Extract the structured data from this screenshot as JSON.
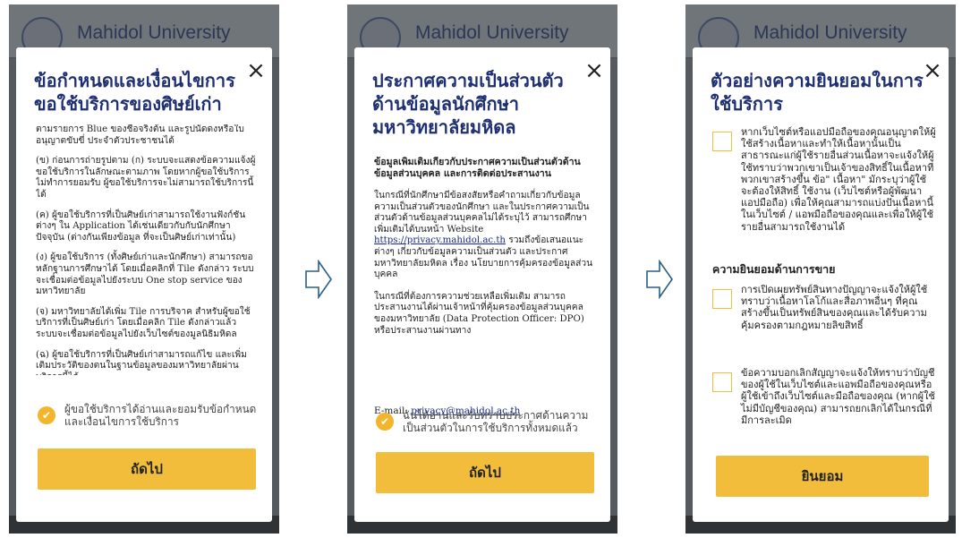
{
  "background": {
    "brand_name": "Mahidol University"
  },
  "screen1": {
    "title": "ข้อกำหนดและเงื่อนไขการขอใช้บริการของศิษย์เก่า",
    "paragraphs": [
      "ตามรายการ Blue ของชื่อจริงต้น และรูปนัดดงหรือใบอนุญาตขับขี่ ประจำตัวประชาชนได้",
      "(ข) ก่อนการถ่ายรูปตาม (ก) ระบบจะแสดงข้อความแจ้งผู้ขอใช้บริการในลักษณะตามภาพ โดยหากผู้ขอใช้บริการไม่ทำการยอมรับ ผู้ขอใช้บริการจะไม่สามารถใช้บริการนี้ได้",
      "(ค) ผู้ขอใช้บริการที่เป็นศิษย์เก่าสามารถใช้งานฟังก์ชันต่างๆ ใน Application ได้เช่นเดียวกับกับนักศึกษาปัจจุบัน (ต่างกันเพียงข้อมูล ที่จะเป็นศิษย์เก่าเท่านั้น)",
      "(ง) ผู้ขอใช้บริการ (ทั้งศิษย์เก่าและนักศึกษา) สามารถขอหลักฐานการศึกษาได้ โดยเมื่อคลิกที่ Tile ดังกล่าว ระบบจะเชื่อมต่อข้อมูลไปยังระบบ One stop service ของมหาวิทยาลัย",
      "(จ) มหาวิทยาลัยได้เพิ่ม Tile การบริจาค สำหรับผู้ขอใช้บริการที่เป็นศิษย์เก่า โดยเมื่อคลิก Tile ดังกล่าวแล้ว ระบบจะเชื่อมต่อข้อมูลไปยังเว็บไซต์ของมูลนิธิมหิดล",
      "(ฉ) ผู้ขอใช้บริการที่เป็นศิษย์เก่าสามารถแก้ไข และเพิ่มเติมประวัติของตนในฐานข้อมูลของมหาวิทยาลัยผ่านบริการนี้ได้"
    ],
    "consent_text": "ผู้ขอใช้บริการได้อ่านและยอมรับข้อกำหนดและเงื่อนไขการใช้บริการ",
    "next_label": "ถัดไป"
  },
  "screen2": {
    "title": "ประกาศความเป็นส่วนตัวด้านข้อมูลนักศึกษา มหาวิทยาลัยมหิดล",
    "subheading": "ข้อมูลเพิ่มเติมเกี่ยวกับประกาศความเป็นส่วนตัวด้านข้อมูลส่วนบุคคล และการติดต่อประสานงาน",
    "para1_before_link": "ในกรณีที่นักศึกษามีข้อสงสัยหรือคำถามเกี่ยวกับข้อมูลความเป็นส่วนตัวของนักศึกษา และในประกาศความเป็นส่วนตัวด้านข้อมูลส่วนบุคคลไม่ได้ระบุไว้ สามารถศึกษาเพิ่มเติมได้บนหน้า Website ",
    "para1_link": "https://privacy.mahidol.ac.th",
    "para1_after_link": " รวมถึงข้อเสนอแนะต่างๆ เกี่ยวกับข้อมูลความเป็นส่วนตัว และประกาศมหาวิทยาลัยมหิดล เรื่อง นโยบายการคุ้มครองข้อมูลส่วนบุคคล",
    "para2": "ในกรณีที่ต้องการความช่วยเหลือเพิ่มเติม สามารถประสานงานได้ผ่านเจ้าหน้าที่คุ้มครองข้อมูลส่วนบุคคลของมหาวิทยาลัย (Data Protection Officer: DPO) หรือประสานงานผ่านทาง",
    "email_label": "E-mail: ",
    "email_link": "privacy@mahidol.ac.th",
    "consent_text": "ฉันได้อ่านและรับทราบประกาศด้านความเป็นส่วนตัวในการใช้บริการทั้งหมดแล้ว",
    "next_label": "ถัดไป"
  },
  "screen3": {
    "title": "ตัวอย่างความยินยอมในการใช้บริการ",
    "item1": "หากเว็บไซต์หรือแอปมือถือของคุณอนุญาตให้ผู้ใช้สร้างเนื้อหาและทำให้เนื้อหานั้นเป็นสาธารณะแก่ผู้ใช้รายอื่นส่วนเนื้อหาจะแจ้งให้ผู้ใช้ทราบว่าพวกเขาเป็นเจ้าของสิทธิ์ในเนื้อหาที่พวกเขาสร้างขึ้น ข้อ\" เนื้อหา\" มักระบุว่าผู้ใช้จะต้องให้สิทธิ์ ใช้งาน (เว็บไซต์หรือผู้พัฒนาแอปมือถือ) เพื่อให้คุณสามารถแบ่งปันเนื้อหานี้ในเว็บไซต์ / แอพมือถือของคุณและเพื่อให้ผู้ใช้รายอื่นสามารถใช้งานได้",
    "section_title": "ความยินยอมด้านการขาย",
    "item2": "การเปิดเผยทรัพย์สินทางปัญญาจะแจ้งให้ผู้ใช้ทราบว่าเนื้อหาโลโก้และสื่อภาพอื่นๆ ที่คุณสร้างขึ้นเป็นทรัพย์สินของคุณและได้รับความคุ้มครองตามกฎหมายลิขสิทธิ์",
    "item3": "ข้อความบอกเลิกสัญญาจะแจ้งให้ทราบว่าบัญชีของผู้ใช้ในเว็บไซต์และแอพมือถือของคุณหรือผู้ใช้เข้าถึงเว็บไซต์และมือถือของคุณ (หากผู้ใช้ไม่มีบัญชีของคุณ) สามารถยกเลิกได้ในกรณีที่มีการละเมิด",
    "accept_label": "ยินยอม"
  },
  "icons": {
    "close": "×",
    "check": "✔"
  },
  "colors": {
    "accent": "#f2bd3b",
    "title": "#1e2f74",
    "arrow": "#2a5f86"
  }
}
